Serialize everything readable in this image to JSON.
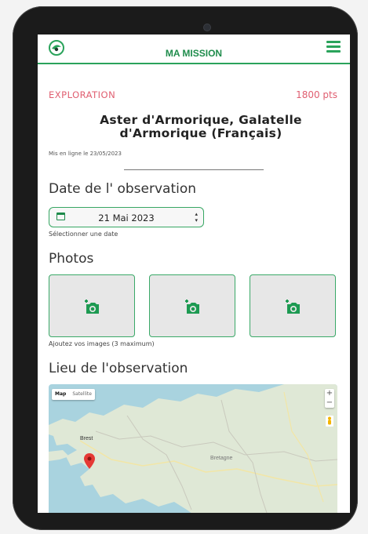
{
  "header": {
    "title": "MA MISSION"
  },
  "mission": {
    "category": "EXPLORATION",
    "points": "1800 pts",
    "title_line1": "Aster d'Armorique, Galatelle",
    "title_line2": "d'Armorique (Français)",
    "published": "Mis en ligne le 23/05/2023"
  },
  "observation_date": {
    "heading": "Date de l' observation",
    "value": "21 Mai 2023",
    "hint": "Sélectionner une date"
  },
  "photos": {
    "heading": "Photos",
    "hint": "Ajoutez vos images (3 maximum)",
    "slots": 3
  },
  "location": {
    "heading": "Lieu de l'observation",
    "map_type_options": [
      "Map",
      "Satellite"
    ],
    "map_type_selected": "Map",
    "place_labels": [
      "Brest",
      "Bretagne"
    ],
    "zoom_in": "+",
    "zoom_out": "−"
  },
  "colors": {
    "brand_green": "#2aa35b",
    "accent_pink": "#e05f71",
    "map_water": "#a9d3df",
    "map_land": "#dfe8d6",
    "pin_red": "#e53935"
  },
  "icons": [
    "app-logo-icon",
    "menu-icon",
    "calendar-icon",
    "add-photo-icon",
    "map-pin-icon",
    "pegman-icon"
  ]
}
